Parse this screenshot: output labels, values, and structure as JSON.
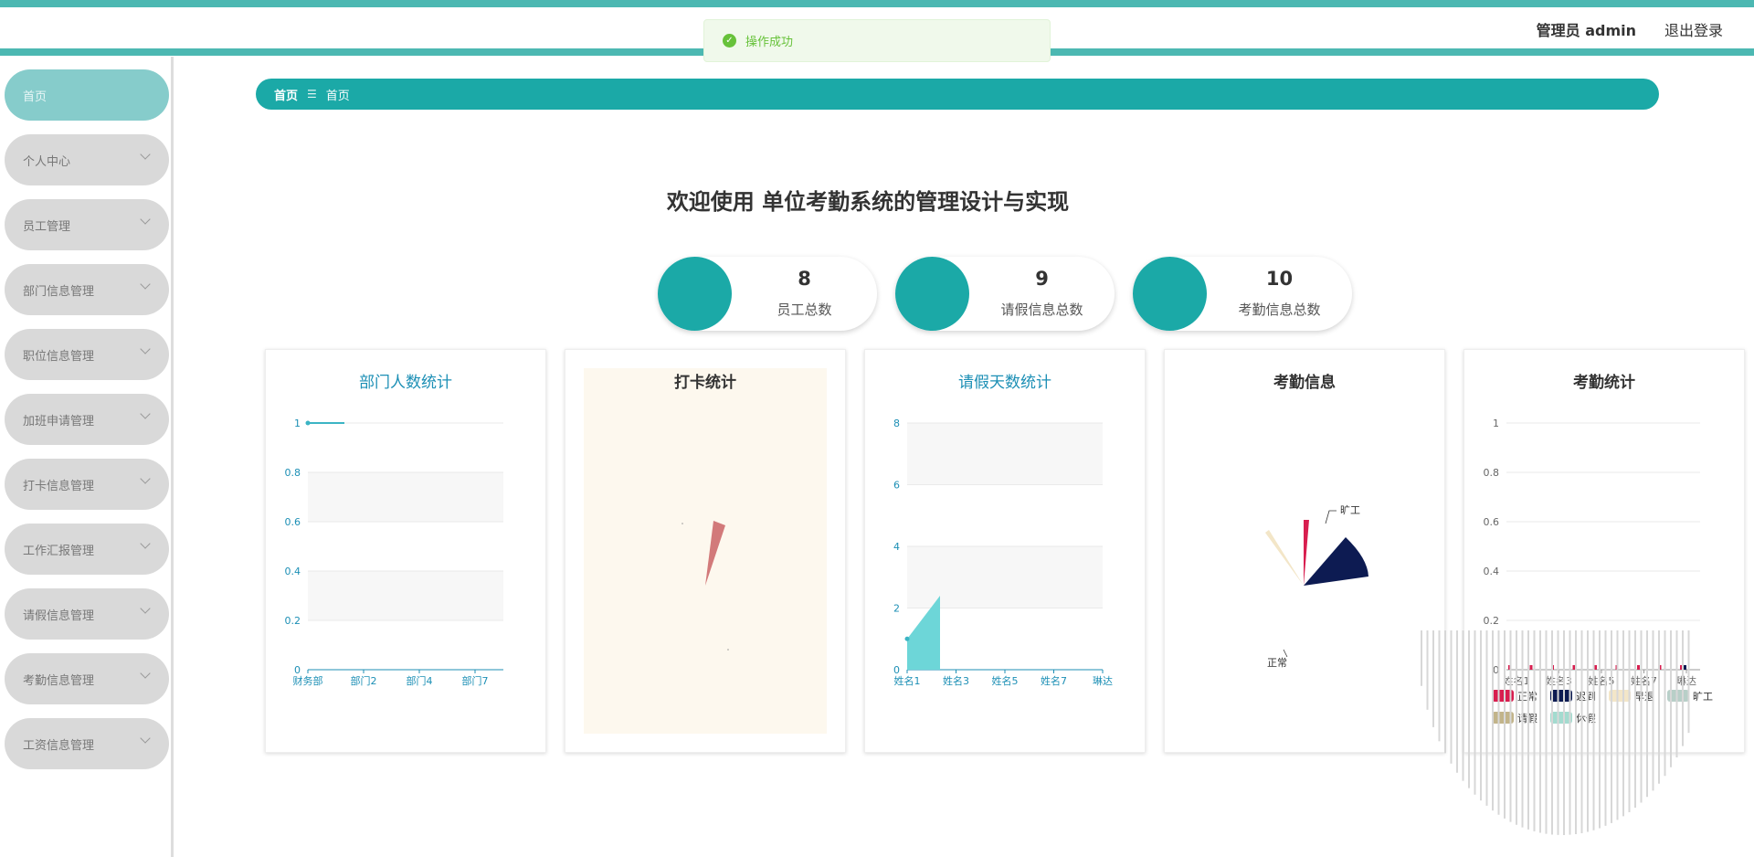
{
  "header": {
    "user_label": "管理员 admin",
    "logout_label": "退出登录",
    "accent_color": "#4cb8b2"
  },
  "toast": {
    "message": "操作成功",
    "icon": "check-circle-icon"
  },
  "sidebar": {
    "items": [
      {
        "label": "首页",
        "active": true
      },
      {
        "label": "个人中心"
      },
      {
        "label": "员工管理"
      },
      {
        "label": "部门信息管理"
      },
      {
        "label": "职位信息管理"
      },
      {
        "label": "加班申请管理"
      },
      {
        "label": "打卡信息管理"
      },
      {
        "label": "工作汇报管理"
      },
      {
        "label": "请假信息管理"
      },
      {
        "label": "考勤信息管理"
      },
      {
        "label": "工资信息管理"
      }
    ]
  },
  "breadcrumb": {
    "root": "首页",
    "current": "首页"
  },
  "welcome": "欢迎使用 单位考勤系统的管理设计与实现",
  "stats": [
    {
      "value": "8",
      "label": "员工总数"
    },
    {
      "value": "9",
      "label": "请假信息总数"
    },
    {
      "value": "10",
      "label": "考勤信息总数"
    }
  ],
  "chart_data": [
    {
      "type": "line",
      "title": "部门人数统计",
      "categories": [
        "财务部",
        "部门2",
        "部门4",
        "部门7"
      ],
      "values": [
        1
      ],
      "ylim": [
        0,
        1
      ],
      "yticks": [
        "0",
        "0.2",
        "0.4",
        "0.6",
        "0.8",
        "1"
      ]
    },
    {
      "type": "pie",
      "title": "打卡统计",
      "background": "#fdf8ee"
    },
    {
      "type": "area",
      "title": "请假天数统计",
      "categories": [
        "姓名1",
        "姓名3",
        "姓名5",
        "姓名7",
        "琳达"
      ],
      "values": [
        1,
        2.4
      ],
      "ylim": [
        0,
        8
      ],
      "yticks": [
        "0",
        "2",
        "4",
        "6",
        "8"
      ],
      "color": "#6dd6d8"
    },
    {
      "type": "pie",
      "title": "考勤信息",
      "labels": [
        "旷工",
        "正常"
      ],
      "colors": [
        "#d81e4f",
        "#0d1b52",
        "#f3e6c8"
      ]
    },
    {
      "type": "bar",
      "title": "考勤统计",
      "categories": [
        "姓名1",
        "姓名3",
        "姓名5",
        "姓名7",
        "琳达"
      ],
      "ylim": [
        0,
        1
      ],
      "yticks": [
        "0",
        "0.2",
        "0.4",
        "0.6",
        "0.8",
        "1"
      ],
      "legend": [
        {
          "name": "正常",
          "color": "#d81e4f"
        },
        {
          "name": "迟到",
          "color": "#0d1b52"
        },
        {
          "name": "早退",
          "color": "#f3e6c8"
        },
        {
          "name": "旷工",
          "color": "#b8cfc8"
        },
        {
          "name": "请假",
          "color": "#c2b48a"
        },
        {
          "name": "休假",
          "color": "#a3dbcf"
        }
      ]
    }
  ]
}
